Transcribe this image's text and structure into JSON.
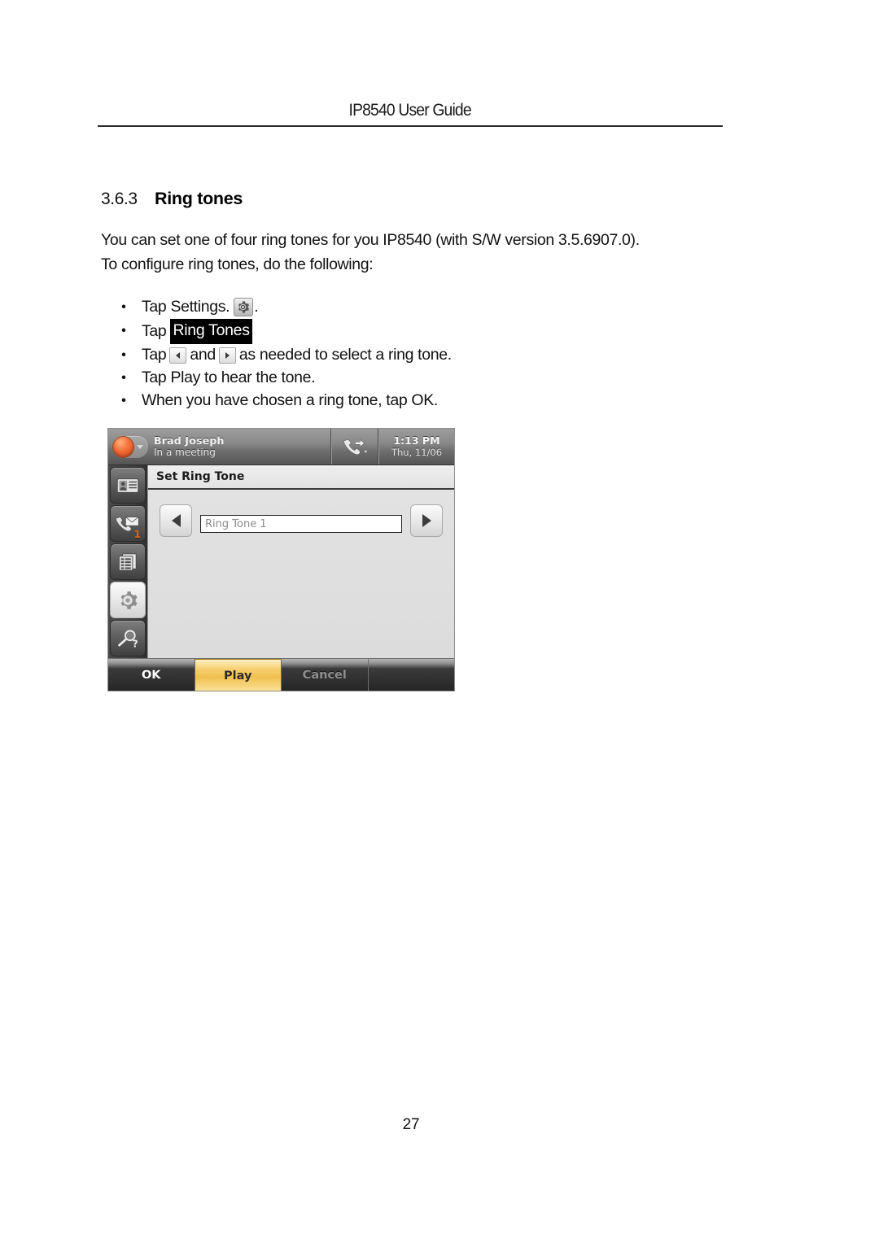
{
  "document": {
    "running_header": "IP8540 User Guide",
    "page_number": "27"
  },
  "section": {
    "number": "3.6.3",
    "title": "Ring tones"
  },
  "intro": {
    "line1": "You can set one of four ring tones for you IP8540 (with S/W version 3.5.6907.0).",
    "line2": "To configure ring tones, do the following:"
  },
  "steps": {
    "step1_before": "Tap Settings.",
    "step1_after": ".",
    "step1_icon": "gear-icon",
    "step2_before": "Tap",
    "step2_highlight": "Ring Tones",
    "step3_before": "Tap",
    "step3_middle": "and",
    "step3_after": "as needed to select a ring tone.",
    "step4": "Tap Play to hear the tone.",
    "step5": "When you have chosen a ring tone, tap OK."
  },
  "phone": {
    "status": {
      "user_name": "Brad Joseph",
      "presence_text": "In a meeting",
      "presence_color": "#f4713a",
      "time": "1:13 PM",
      "date": "Thu, 11/06",
      "forward_icon": "call-forward-icon"
    },
    "sidebar": [
      {
        "name": "contacts",
        "icon": "contact-card-icon",
        "selected": false,
        "badge": ""
      },
      {
        "name": "voicemail",
        "icon": "voicemail-envelope-icon",
        "selected": false,
        "badge": "1"
      },
      {
        "name": "directory",
        "icon": "directory-list-icon",
        "selected": false,
        "badge": ""
      },
      {
        "name": "settings",
        "icon": "gear-icon",
        "selected": true,
        "badge": ""
      },
      {
        "name": "help",
        "icon": "magnifier-question-icon",
        "selected": false,
        "badge": ""
      }
    ],
    "screen": {
      "title": "Set Ring Tone",
      "prev_icon": "arrow-left-icon",
      "next_icon": "arrow-right-icon",
      "tone_value": "Ring Tone 1"
    },
    "buttons": {
      "ok": "OK",
      "play": "Play",
      "cancel": "Cancel",
      "blank": ""
    },
    "colors": {
      "play_accent": "#f0c04f",
      "badge_orange": "#e8620c"
    }
  }
}
